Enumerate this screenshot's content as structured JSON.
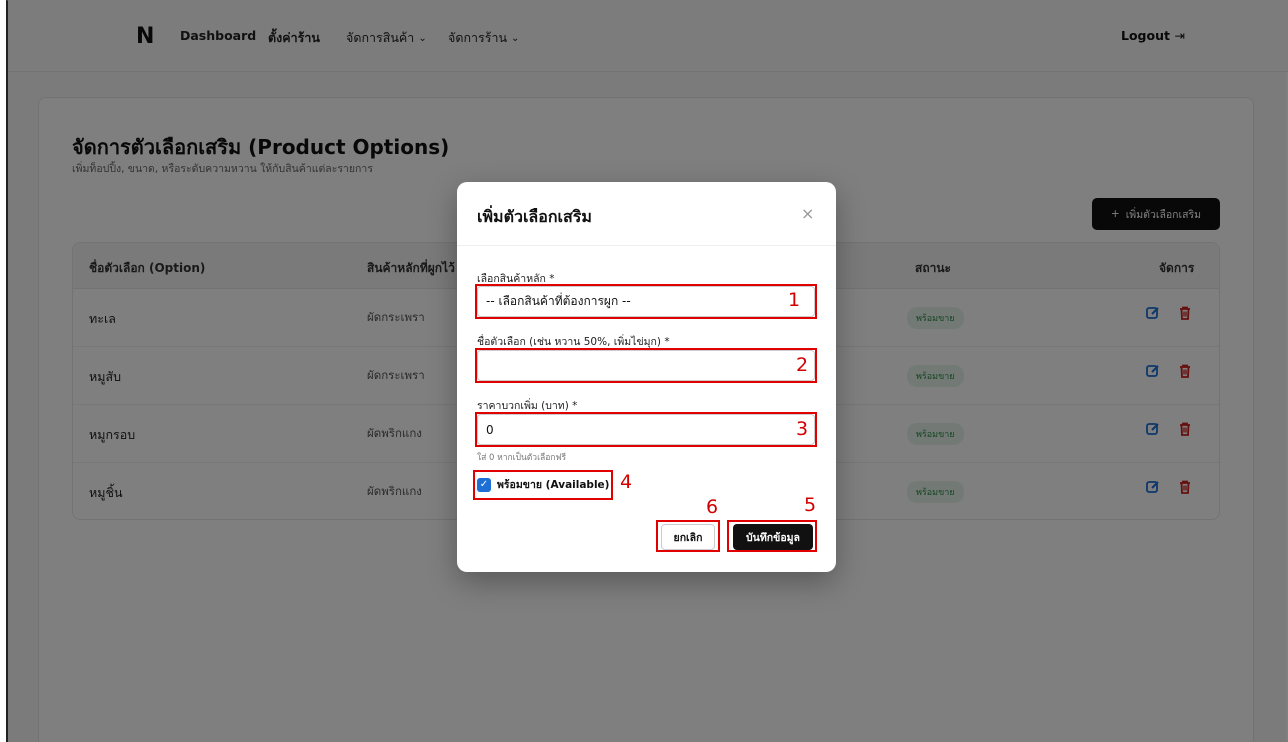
{
  "nav": {
    "logo": "N",
    "dashboard": "Dashboard",
    "settings": "ตั้งค่าร้าน",
    "products": "จัดการสินค้า",
    "store": "จัดการร้าน",
    "logout": "Logout",
    "logout_icon": "logout-icon",
    "chevron_icon": "chevron-down-icon"
  },
  "page": {
    "title": "จัดการตัวเลือกเสริม (Product Options)",
    "subtitle": "เพิ่มท็อปปิ้ง, ขนาด, หรือระดับความหวาน ให้กับสินค้าแต่ละรายการ",
    "add_button": "เพิ่มตัวเลือกเสริม"
  },
  "table": {
    "headers": {
      "option": "ชื่อตัวเลือก (Option)",
      "product": "สินค้าหลักที่ผูกไว้",
      "status": "สถานะ",
      "actions": "จัดการ"
    },
    "rows": [
      {
        "option": "ทะเล",
        "product": "ผัดกระเพรา",
        "status": "พร้อมขาย"
      },
      {
        "option": "หมูสับ",
        "product": "ผัดกระเพรา",
        "status": "พร้อมขาย"
      },
      {
        "option": "หมูกรอบ",
        "product": "ผัดพริกแกง",
        "status": "พร้อมขาย"
      },
      {
        "option": "หมูชิ้น",
        "product": "ผัดพริกแกง",
        "status": "พร้อมขาย"
      }
    ]
  },
  "modal": {
    "title": "เพิ่มตัวเลือกเสริม",
    "close": "×",
    "product_label": "เลือกสินค้าหลัก *",
    "product_value": "-- เลือกสินค้าที่ต้องการผูก --",
    "name_label": "ชื่อตัวเลือก (เช่น หวาน 50%, เพิ่มไข่มุก) *",
    "name_value": "",
    "price_label": "ราคาบวกเพิ่ม (บาท) *",
    "price_value": "0",
    "price_hint": "ใส่ 0 หากเป็นตัวเลือกฟรี",
    "available_label": "พร้อมขาย (Available)",
    "available_checked": true,
    "cancel": "ยกเลิก",
    "save": "บันทึกข้อมูล"
  },
  "annotations": [
    "1",
    "2",
    "3",
    "4",
    "5",
    "6"
  ],
  "colors": {
    "annotation": "#e00000",
    "primary": "#111111",
    "badge_bg": "#e6f5ea",
    "badge_text": "#2e8b4a",
    "edit_icon": "#1d6fd6",
    "delete_icon": "#cc1f1f"
  }
}
